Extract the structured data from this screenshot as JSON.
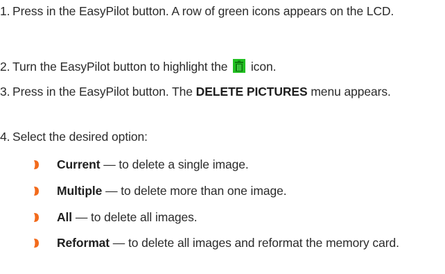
{
  "steps": [
    {
      "num": "1.",
      "text": "Press in the EasyPilot button. A row of green icons appears on the LCD."
    },
    {
      "num": "2.",
      "pre": "Turn the EasyPilot button to highlight the",
      "post": "icon.",
      "icon": "trash-icon"
    },
    {
      "num": "3.",
      "pre": "Press in the EasyPilot button. The",
      "bold": "DELETE PICTURES",
      "post": "menu appears."
    },
    {
      "num": "4.",
      "text": "Select the desired option:"
    }
  ],
  "options": [
    {
      "bold": "Current",
      "text": " — to delete a single image."
    },
    {
      "bold": "Multiple",
      "text": " — to delete more than one image."
    },
    {
      "bold": "All",
      "text": " — to delete all images."
    },
    {
      "bold": "Reformat",
      "text": " — to delete all images and reformat the memory card."
    }
  ],
  "colors": {
    "bullet": "#f26a1b",
    "icon_fill": "#22c022"
  }
}
